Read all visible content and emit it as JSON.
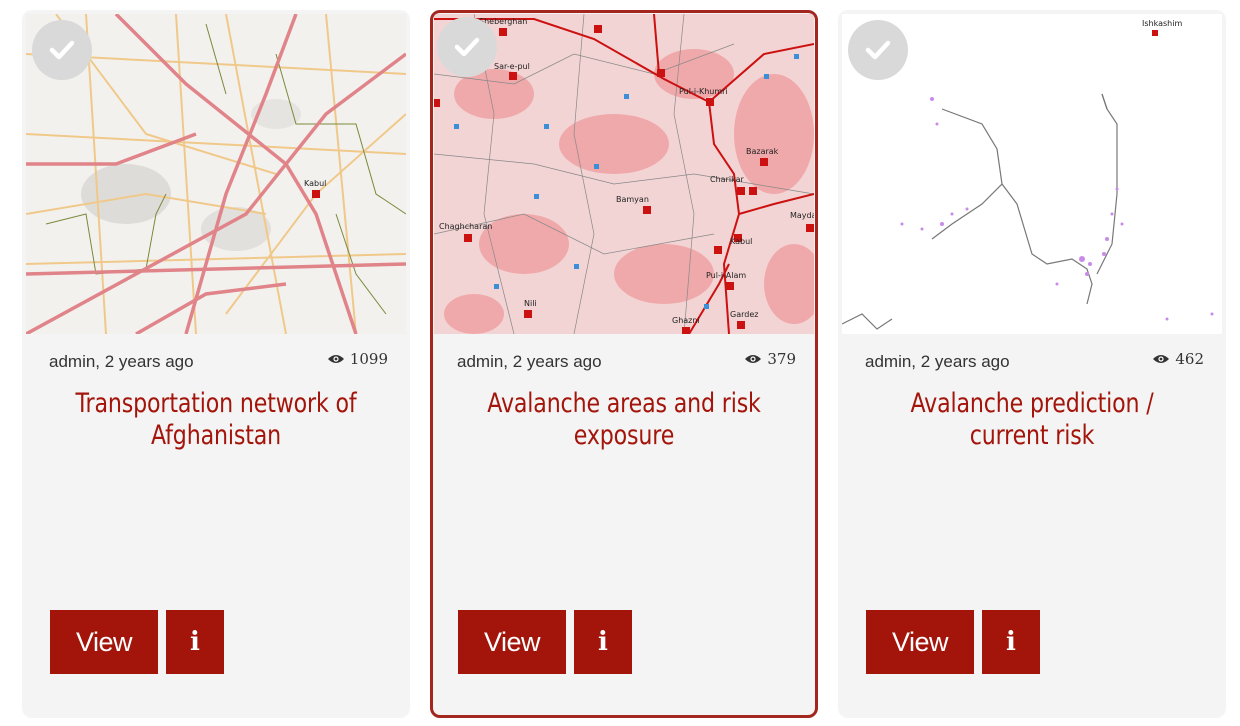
{
  "cards": [
    {
      "title": "Transportation network of Afghanistan",
      "author": "admin, 2 years ago",
      "views": "1099",
      "view_label": "View",
      "info_label": "i",
      "map_labels": [
        "Kabul"
      ]
    },
    {
      "title": "Avalanche areas and risk exposure",
      "author": "admin, 2 years ago",
      "views": "379",
      "view_label": "View",
      "info_label": "i",
      "map_labels": [
        "Sheberghan",
        "Sar-e-pul",
        "Pul-i-Khumri",
        "Bazarak",
        "Charikar",
        "Chaghcharan",
        "Bamyan",
        "Kabul",
        "Mayda",
        "Pul-i-Alam",
        "Nili",
        "Ghazni",
        "Gardez"
      ]
    },
    {
      "title": "Avalanche prediction / current risk",
      "author": "admin, 2 years ago",
      "views": "462",
      "view_label": "View",
      "info_label": "i",
      "map_labels": [
        "Ishkashim"
      ]
    }
  ],
  "colors": {
    "accent": "#a3150b",
    "selected_border": "#a3271f",
    "card_bg": "#f4f4f4"
  },
  "icons": {
    "select": "check-icon",
    "views": "eye-icon",
    "info": "info-icon"
  }
}
